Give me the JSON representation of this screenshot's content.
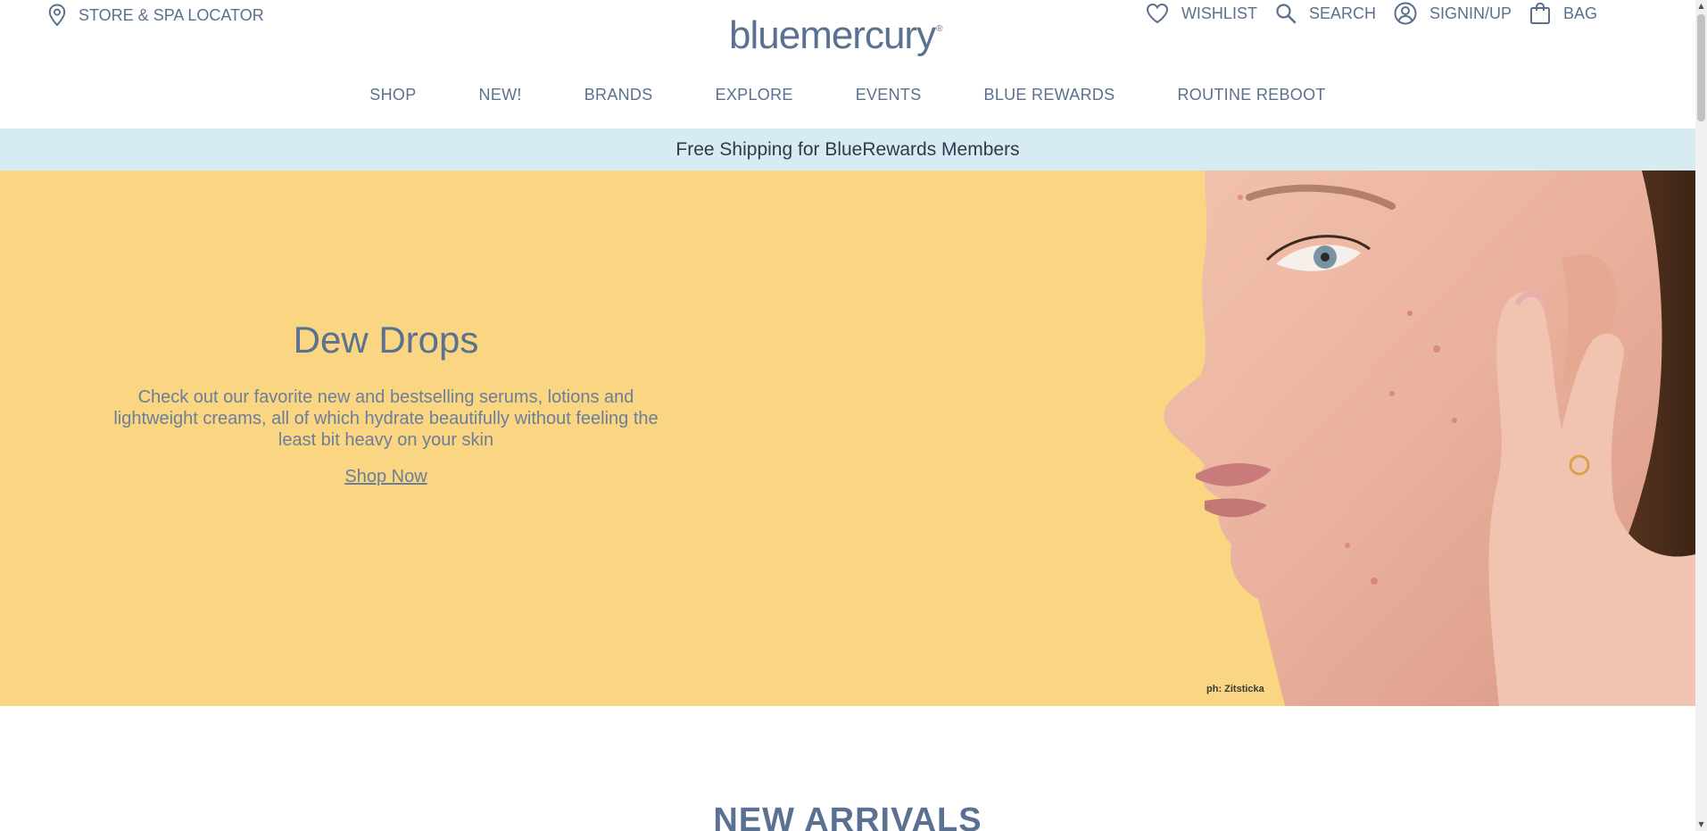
{
  "header": {
    "locator_label": "STORE & SPA LOCATOR",
    "logo_text": "bluemercury",
    "logo_mark": "®",
    "util": [
      {
        "label": "WISHLIST",
        "icon": "heart-icon"
      },
      {
        "label": "SEARCH",
        "icon": "search-icon"
      },
      {
        "label": "SIGNIN/UP",
        "icon": "user-icon"
      },
      {
        "label": "BAG",
        "icon": "bag-icon"
      }
    ]
  },
  "nav": {
    "items": [
      "SHOP",
      "NEW!",
      "BRANDS",
      "EXPLORE",
      "EVENTS",
      "BLUE REWARDS",
      "ROUTINE REBOOT"
    ]
  },
  "promo": {
    "text": "Free Shipping for BlueRewards Members"
  },
  "hero": {
    "title": "Dew Drops",
    "body": "Check out our favorite new and bestselling serums, lotions and lightweight creams, all of which hydrate beautifully without feeling the least bit heavy on your skin",
    "cta": "Shop Now",
    "photo_credit": "ph: Zitsticka",
    "background_color": "#fad582"
  },
  "section": {
    "title": "NEW ARRIVALS"
  },
  "colors": {
    "brand": "#5a7191",
    "promo_bg": "#d6ebf2"
  }
}
